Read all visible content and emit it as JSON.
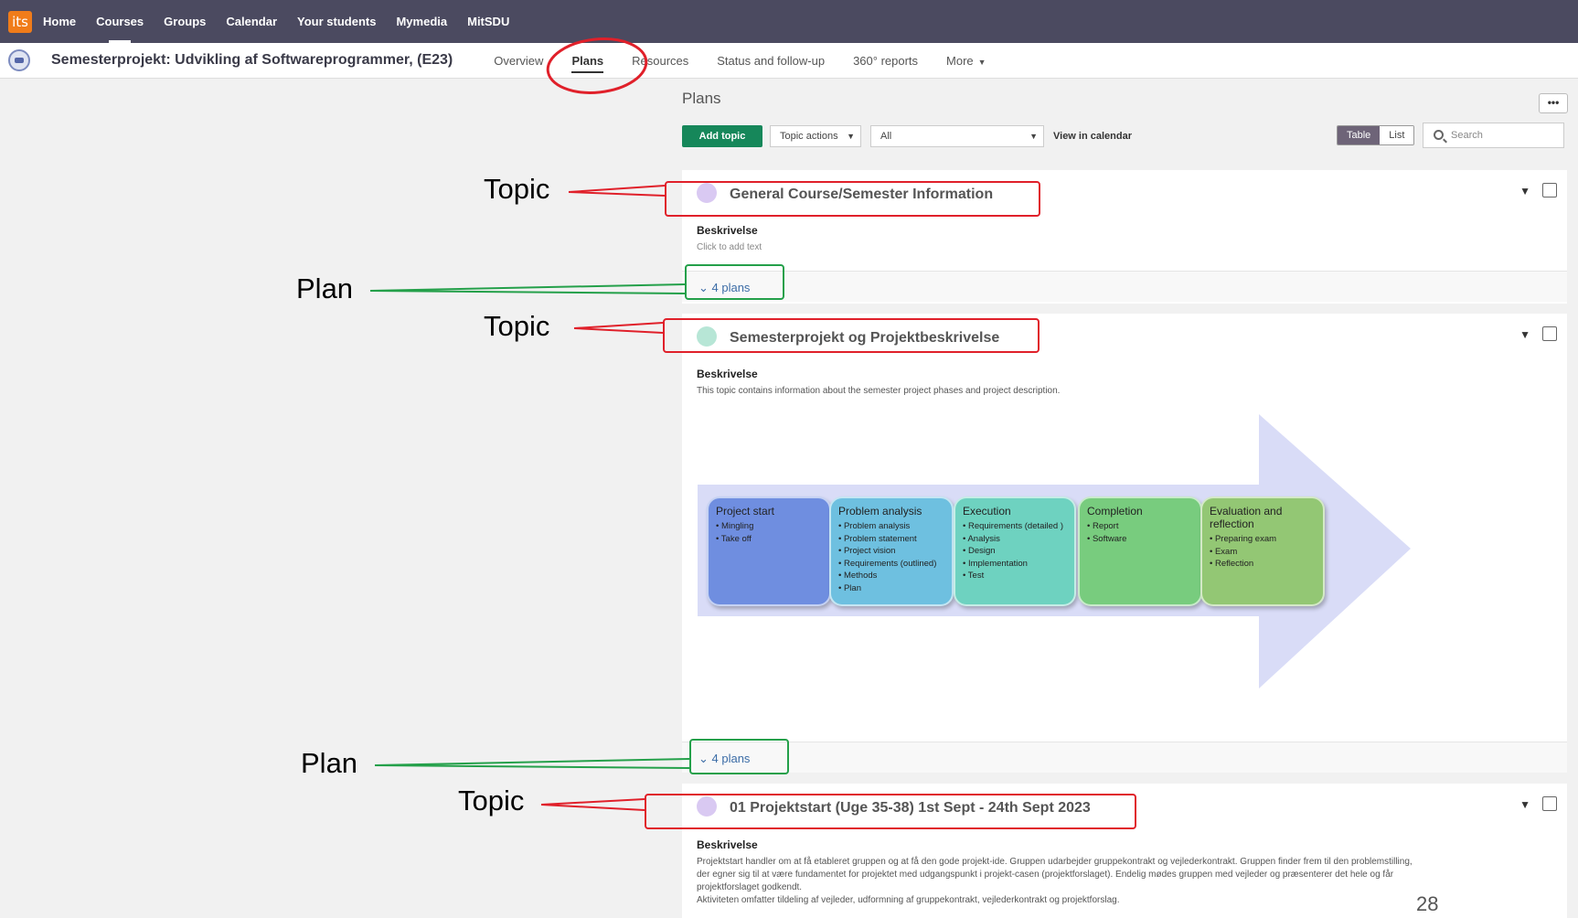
{
  "topnav": {
    "logo": "its",
    "items": [
      "Home",
      "Courses",
      "Groups",
      "Calendar",
      "Your students",
      "Mymedia",
      "MitSDU"
    ]
  },
  "subheader": {
    "course_title": "Semesterprojekt: Udvikling af Softwareprogrammer, (E23)",
    "tabs": [
      "Overview",
      "Plans",
      "Resources",
      "Status and follow-up",
      "360° reports",
      "More"
    ],
    "active_tab": "Plans"
  },
  "page": {
    "heading": "Plans",
    "options_button": "•••"
  },
  "toolbar": {
    "add_topic": "Add topic",
    "topic_actions": "Topic actions",
    "filter_value": "All",
    "view_in_calendar": "View in calendar",
    "view_table": "Table",
    "view_list": "List",
    "search_placeholder": "Search"
  },
  "topics": [
    {
      "title": "General Course/Semester Information",
      "dot_color": "#d9c9f2",
      "description_label": "Beskrivelse",
      "description": "Click to add text",
      "plans_link": "4 plans"
    },
    {
      "title": "Semesterprojekt og Projektbeskrivelse",
      "dot_color": "#b7e6d6",
      "description_label": "Beskrivelse",
      "description": "This topic contains information about the semester project phases and project description.",
      "plans_link": "4 plans",
      "diagram": {
        "phases": [
          {
            "title": "Project start",
            "items": [
              "Mingling",
              "Take off"
            ],
            "color": "#6f8ee0"
          },
          {
            "title": "Problem analysis",
            "items": [
              "Problem analysis",
              "Problem statement",
              "Project vision",
              "Requirements (outlined)",
              "Methods",
              "Plan"
            ],
            "color": "#6ec0e0"
          },
          {
            "title": "Execution",
            "items": [
              "Requirements (detailed )",
              "Analysis",
              "Design",
              "Implementation",
              "Test"
            ],
            "color": "#6ed2c0"
          },
          {
            "title": "Completion",
            "items": [
              "Report",
              "Software"
            ],
            "color": "#78cc7e"
          },
          {
            "title": "Evaluation and reflection",
            "items": [
              "Preparing exam",
              "Exam",
              "Reflection"
            ],
            "color": "#93c774"
          }
        ]
      }
    },
    {
      "title": "01 Projektstart (Uge 35-38)  1st Sept - 24th Sept 2023",
      "dot_color": "#d9c9f2",
      "description_label": "Beskrivelse",
      "description_lines": [
        "Projektstart handler om at få etableret gruppen og at få den gode projekt-ide. Gruppen udarbejder gruppekontrakt og vejlederkontrakt. Gruppen finder frem til den problemstilling,",
        "der egner sig til at være fundamentet for projektet med udgangspunkt i projekt-casen (projektforslaget). Endelig mødes gruppen med vejleder og præsenterer det hele og får",
        "projektforslaget godkendt.",
        "Aktiviteten omfatter tildeling af vejleder, udformning af gruppekontrakt, vejlederkontrakt og projektforslag."
      ]
    }
  ],
  "annotations": {
    "topic_label": "Topic",
    "plan_label": "Plan",
    "highlight_color": "#e0202a",
    "plan_color": "#24a04a"
  },
  "page_number": "28"
}
